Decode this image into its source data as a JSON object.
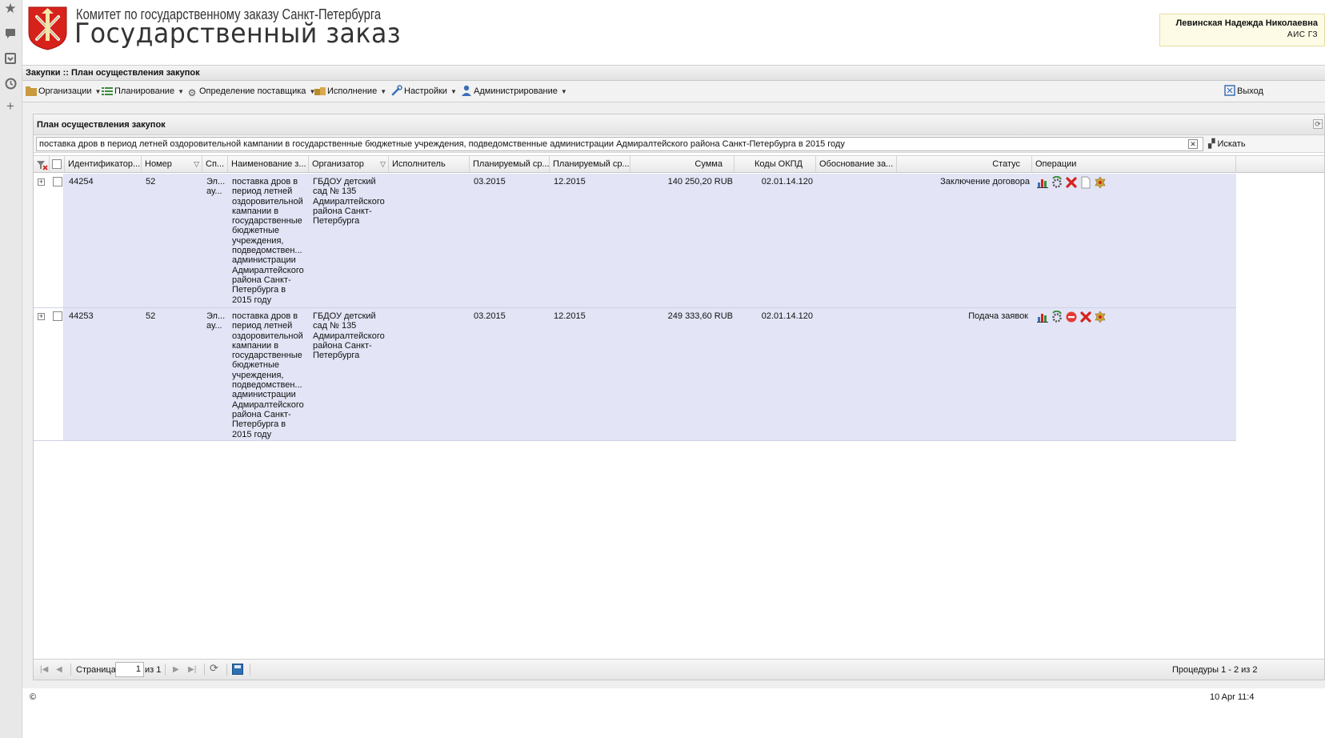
{
  "header": {
    "org_name": "Комитет по государственному заказу Санкт-Петербурга",
    "app_name": "Государственный заказ",
    "user_name": "Левинская Надежда Николаевна",
    "user_role": "АИС ГЗ"
  },
  "breadcrumb": "Закупки :: План осуществления закупок",
  "menu": {
    "items": [
      {
        "label": "Организации",
        "icon": "folder-icon"
      },
      {
        "label": "Планирование",
        "icon": "list-icon"
      },
      {
        "label": "Определение поставщика",
        "icon": "gears-icon"
      },
      {
        "label": "Исполнение",
        "icon": "boxes-icon"
      },
      {
        "label": "Настройки",
        "icon": "wrench-icon"
      },
      {
        "label": "Администрирование",
        "icon": "user-icon"
      }
    ],
    "exit_label": "Выход"
  },
  "panel": {
    "title": "План осуществления закупок",
    "search_value": "поставка дров в период летней оздоровительной кампании в государственные бюджетные учреждения, подведомственные администрации Адмиралтейского района Санкт-Петербурга в 2015 году",
    "search_button": "Искать"
  },
  "grid": {
    "columns": [
      "Идентификатор...",
      "Номер",
      "Сп...",
      "Наименование з...",
      "Организатор",
      "Исполнитель",
      "Планируемый ср...",
      "Планируемый ср...",
      "Сумма",
      "Коды ОКПД",
      "Обоснование за...",
      "Статус",
      "Операции"
    ],
    "rows": [
      {
        "id": "44254",
        "number": "52",
        "method": "Эл... ау...",
        "name": "поставка дров в период летней оздоровительной кампании в государственные бюджетные учреждения, подведомствен... администрации Адмиралтейского района Санкт-Петербурга в 2015 году",
        "organizer": "ГБДОУ детский сад № 135 Адмиралтейского района Санкт-Петербурга",
        "executor": "",
        "plan_start": "03.2015",
        "plan_end": "12.2015",
        "sum": "140 250,20 RUB",
        "okpd": "02.01.14.120",
        "justification": "",
        "status": "Заключение договора",
        "operations": [
          "chart-icon",
          "refresh-gear-icon",
          "delete-icon",
          "document-icon",
          "emblem-icon"
        ]
      },
      {
        "id": "44253",
        "number": "52",
        "method": "Эл... ау...",
        "name": "поставка дров в период летней оздоровительной кампании в государственные бюджетные учреждения, подведомствен... администрации Адмиралтейского района Санкт-Петербурга в 2015 году",
        "organizer": "ГБДОУ детский сад № 135 Адмиралтейского района Санкт-Петербурга",
        "executor": "",
        "plan_start": "03.2015",
        "plan_end": "12.2015",
        "sum": "249 333,60 RUB",
        "okpd": "02.01.14.120",
        "justification": "",
        "status": "Подача заявок",
        "operations": [
          "chart-icon",
          "refresh-gear-icon",
          "stop-icon",
          "delete-icon",
          "emblem-icon"
        ]
      }
    ]
  },
  "pager": {
    "page_label": "Страница",
    "page_value": "1",
    "of_label": "из 1",
    "summary": "Процедуры 1 - 2 из 2"
  },
  "footer": {
    "copyright": "©",
    "date": "10 Apr 11:4"
  },
  "colors": {
    "row_bg": "#e3e5f6",
    "accent_red": "#d6221b",
    "user_box_bg": "#fdfbe6"
  }
}
